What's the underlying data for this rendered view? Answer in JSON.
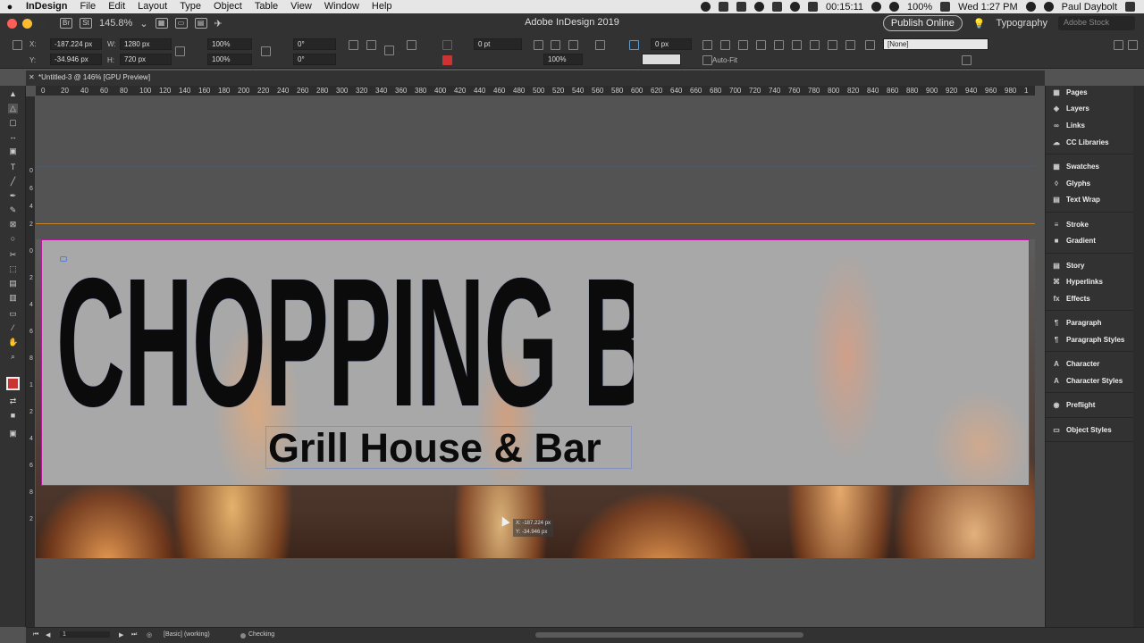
{
  "menubar": {
    "app_name": "InDesign",
    "items": [
      "File",
      "Edit",
      "Layout",
      "Type",
      "Object",
      "Table",
      "View",
      "Window",
      "Help"
    ],
    "timer": "00:15:11",
    "battery": "100%",
    "clock": "Wed 1:27 PM",
    "user": "Paul Daybolt"
  },
  "titlebar": {
    "title": "Adobe InDesign 2019",
    "zoom": "145.8%",
    "publish_label": "Publish Online",
    "workspace": "Typography",
    "stock_placeholder": "Adobe Stock"
  },
  "control": {
    "x_label": "X:",
    "x_value": "-187.224 px",
    "y_label": "Y:",
    "y_value": "-34.946 px",
    "w_label": "W:",
    "w_value": "1280 px",
    "h_label": "H:",
    "h_value": "720 px",
    "scale_x": "100%",
    "scale_y": "100%",
    "rotate": "0°",
    "shear": "0°",
    "stroke_weight": "0 pt",
    "opacity": "100%",
    "gap": "0 px",
    "autofit_label": "Auto-Fit",
    "style": "[None]"
  },
  "document_tab": {
    "label": "*Untitled-3 @ 146% [GPU Preview]"
  },
  "ruler": {
    "h_ticks": [
      "0",
      "20",
      "40",
      "60",
      "80",
      "100",
      "120",
      "140",
      "160",
      "180",
      "200",
      "220",
      "240",
      "260",
      "280",
      "300",
      "320",
      "340",
      "360",
      "380",
      "400",
      "420",
      "440",
      "460",
      "480",
      "500",
      "520",
      "540",
      "560",
      "580",
      "600",
      "620",
      "640",
      "660",
      "680",
      "700",
      "720",
      "740",
      "760",
      "780",
      "800",
      "820",
      "840",
      "860",
      "880",
      "900",
      "920",
      "940",
      "960",
      "980",
      "1"
    ]
  },
  "canvas": {
    "headline": "CHOPPING BLOCK",
    "subtitle": "Grill House & Bar",
    "cursor_readout_x": "X: -187.224 px",
    "cursor_readout_y": "Y: -34.946 px"
  },
  "panels": {
    "items": [
      "Pages",
      "Layers",
      "Links",
      "CC Libraries",
      "Swatches",
      "Glyphs",
      "Text Wrap",
      "Stroke",
      "Gradient",
      "Story",
      "Hyperlinks",
      "Effects",
      "Paragraph",
      "Paragraph Styles",
      "Character",
      "Character Styles",
      "Preflight",
      "Object Styles"
    ]
  },
  "status": {
    "page": "1",
    "profile": "[Basic] (working)",
    "preflight": "Checking"
  },
  "colors": {
    "page_border": "#b3179a",
    "bleed_line": "#c2832c",
    "selection": "#5a7dd1",
    "chrome": "#323232",
    "pasteboard": "#535353"
  }
}
